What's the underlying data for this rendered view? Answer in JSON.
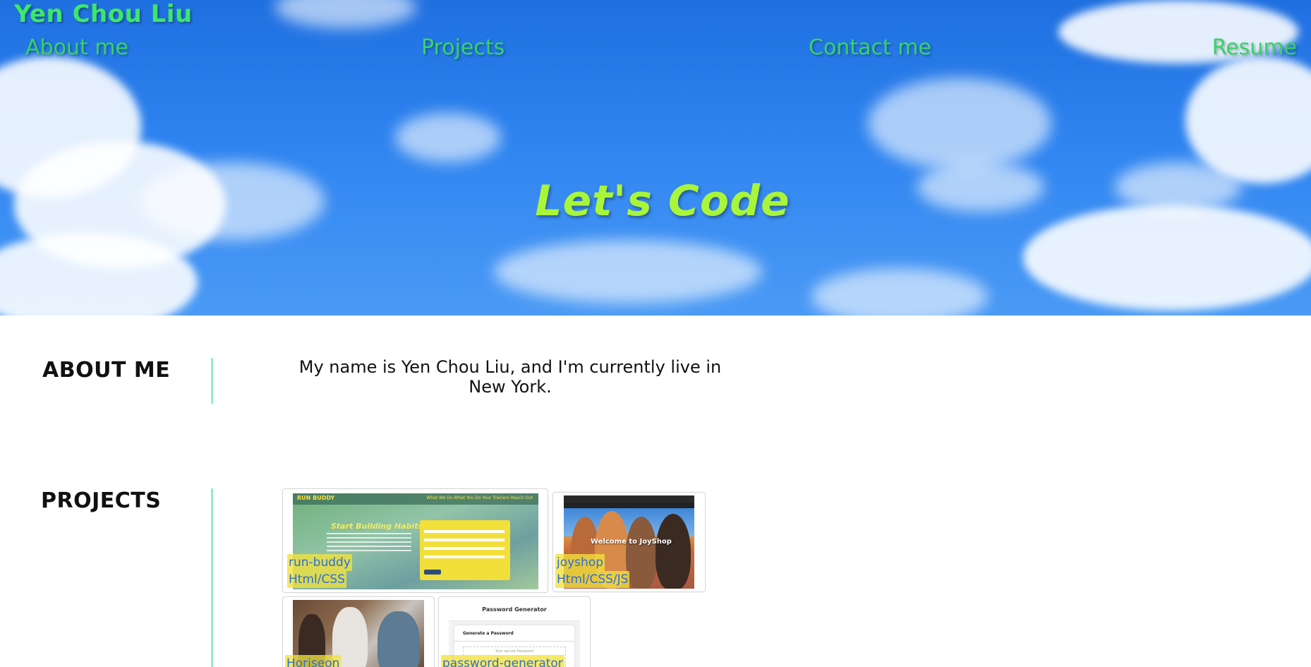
{
  "header": {
    "site_title": "Yen Chou Liu",
    "nav": [
      "About me",
      "Projects",
      "Contact me",
      "Resume"
    ],
    "hero_heading": "Let's Code"
  },
  "about": {
    "title": "ABOUT ME",
    "text": "My name is Yen Chou Liu, and I'm currently live in New York."
  },
  "projects": {
    "title": "PROJECTS",
    "items": [
      {
        "name": "run-buddy",
        "tech": "Html/CSS"
      },
      {
        "name": "joyshop",
        "tech": "Html/CSS/JS"
      },
      {
        "name": "Horiseon",
        "tech": ""
      },
      {
        "name": "password-generator",
        "tech": ""
      }
    ]
  },
  "thumbnails": {
    "run_buddy": {
      "logo": "RUN BUDDY",
      "nav": "What We Do   What You Do   Your Trainers   Reach Out",
      "headline": "Start Building Habits."
    },
    "joyshop": {
      "welcome": "Welcome to JoyShop"
    },
    "password_generator": {
      "title": "Password Generator",
      "subtitle": "Generate a Password",
      "placeholder": "Your secure Password"
    }
  },
  "colors": {
    "nav_green": "#35d466",
    "hero_heading": "#a9f53a",
    "divider": "#8ef0c8",
    "card_label_text": "#2b6fd6",
    "card_label_bg": "#f4e23c"
  }
}
